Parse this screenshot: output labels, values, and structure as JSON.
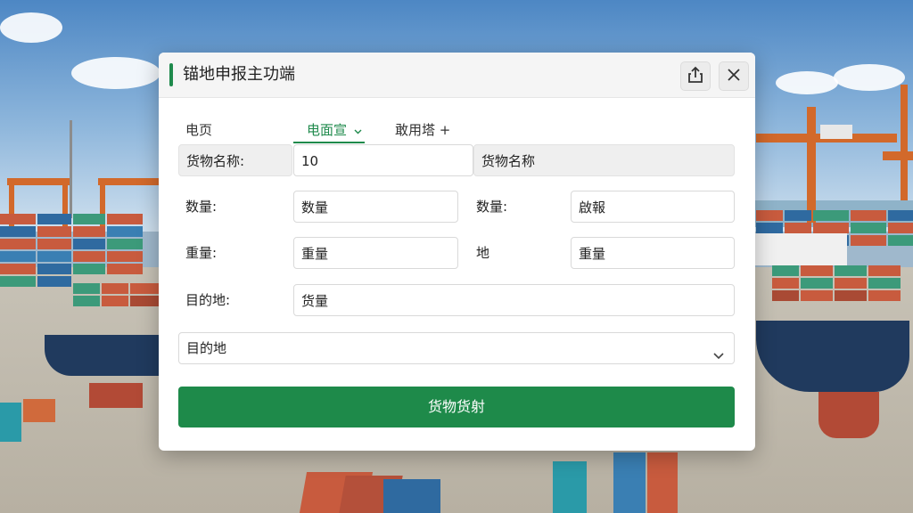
{
  "window": {
    "title": "锚地申报主功端"
  },
  "tabs": [
    {
      "label": "电页",
      "active": false
    },
    {
      "label": "电面宣",
      "active": true,
      "has_dropdown": true
    },
    {
      "label": "敢用塔",
      "active": false,
      "suffix": "+"
    }
  ],
  "form": {
    "row1": {
      "label": "货物名称:",
      "value": "10",
      "extra": "货物名称"
    },
    "row2": {
      "label": "数量:",
      "placeholder": "数量",
      "label2": "数量:",
      "placeholder2": "啟報"
    },
    "row3": {
      "label": "重量:",
      "placeholder": "重量",
      "label2": "地",
      "placeholder2": "重量"
    },
    "row4": {
      "label": "目的地:",
      "placeholder": "货量"
    },
    "destination_select": {
      "value": "目的地"
    },
    "submit_label": "货物货射"
  },
  "colors": {
    "accent": "#1f8a4c",
    "submit": "#1e8a4a",
    "titlebar": "#f5f5f5"
  },
  "icons": {
    "share": "share-icon",
    "close": "close-icon",
    "tab_dropdown": "chevron-down-icon",
    "select_dropdown": "chevron-down-icon"
  }
}
